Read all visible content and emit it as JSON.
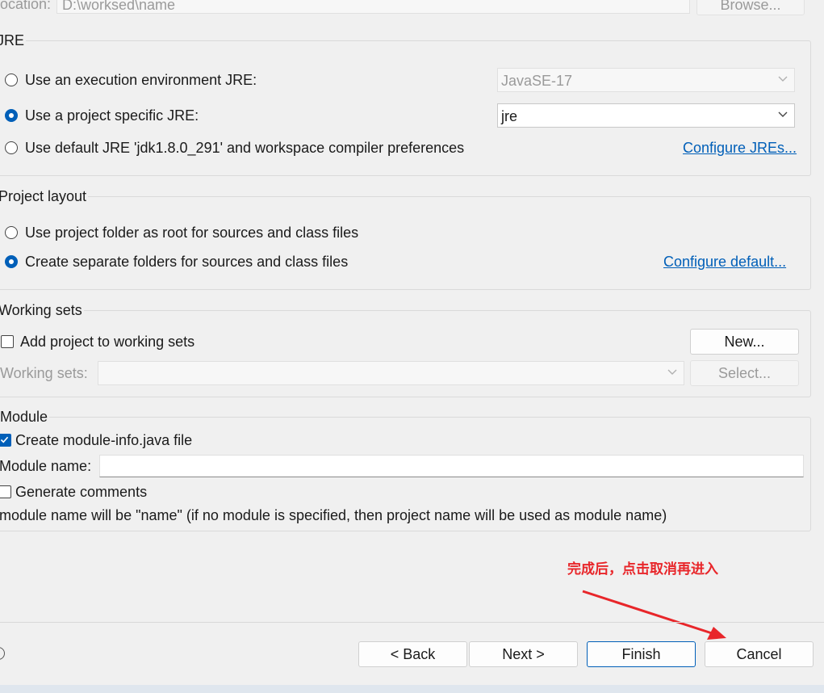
{
  "location": {
    "label": "Location:",
    "value": "D:\\worksed\\name",
    "browse_label": "Browse..."
  },
  "jre": {
    "title": "JRE",
    "option_env": "Use an execution environment JRE:",
    "env_value": "JavaSE-17",
    "option_specific": "Use a project specific JRE:",
    "specific_value": "jre",
    "option_default": "Use default JRE 'jdk1.8.0_291' and workspace compiler preferences",
    "configure_link": "Configure JREs...",
    "selected": "specific"
  },
  "project_layout": {
    "title": "Project layout",
    "option_root": "Use project folder as root for sources and class files",
    "option_separate": "Create separate folders for sources and class files",
    "configure_link": "Configure default...",
    "selected": "separate"
  },
  "working_sets": {
    "title": "Working sets",
    "add_label": "Add project to working sets",
    "add_checked": false,
    "new_button": "New...",
    "sets_label": "Working sets:",
    "sets_value": "",
    "select_button": "Select..."
  },
  "module": {
    "title": "Module",
    "create_label": "Create module-info.java file",
    "create_checked": true,
    "name_label": "Module name:",
    "name_value": "",
    "comments_label": "Generate comments",
    "comments_checked": false,
    "info_text": "module name will be \"name\"  (if no module is specified, then project name will be used as module name)"
  },
  "annotation": {
    "text": "完成后，点击取消再进入",
    "color": "#e8262a"
  },
  "footer": {
    "back_label": "< Back",
    "next_label": "Next >",
    "finish_label": "Finish",
    "cancel_label": "Cancel"
  },
  "colors": {
    "accent": "#005fb8",
    "background": "#f0f0f0",
    "annotation": "#e8262a"
  }
}
